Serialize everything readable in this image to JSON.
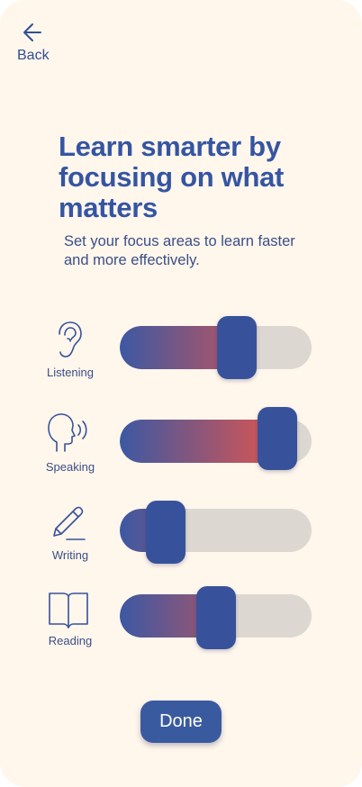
{
  "nav": {
    "back_label": "Back",
    "back_icon": "arrow-left-icon"
  },
  "header": {
    "title": "Learn smarter by focusing on what matters",
    "subtitle": "Set your focus areas to learn faster and more effectively."
  },
  "skills": [
    {
      "label": "Listening",
      "icon": "ear-icon",
      "level": 0.61
    },
    {
      "label": "Speaking",
      "icon": "speaking-head-icon",
      "level": 0.82
    },
    {
      "label": "Writing",
      "icon": "pencil-icon",
      "level": 0.24
    },
    {
      "label": "Reading",
      "icon": "open-book-icon",
      "level": 0.5
    }
  ],
  "actions": {
    "done_label": "Done"
  },
  "colors": {
    "background": "#fff6ec",
    "accent": "#37529a",
    "track": "#dcd8d1",
    "fill_start": "#3c58a3",
    "fill_end": "#d35555",
    "text": "#3a4f86"
  }
}
